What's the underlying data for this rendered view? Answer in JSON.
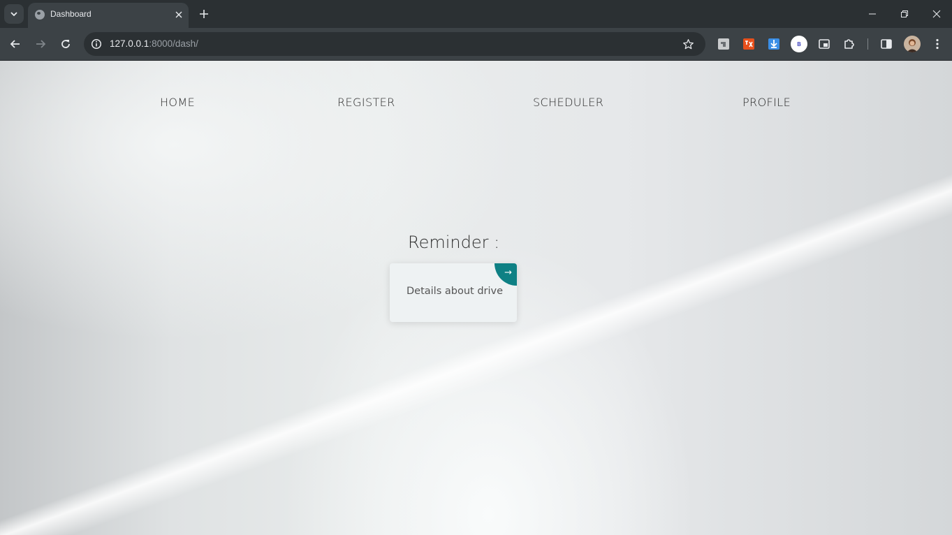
{
  "browser": {
    "tab_title": "Dashboard",
    "url_host": "127.0.0.1",
    "url_rest": ":8000/dash/",
    "extension_avatar_letter": "B"
  },
  "nav": {
    "items": [
      "HOME",
      "REGISTER",
      "SCHEDULER",
      "PROFILE"
    ]
  },
  "reminder": {
    "title": "Reminder :",
    "card_text": "Details about drive",
    "card_arrow": "→",
    "accent_color": "#0e8084"
  }
}
